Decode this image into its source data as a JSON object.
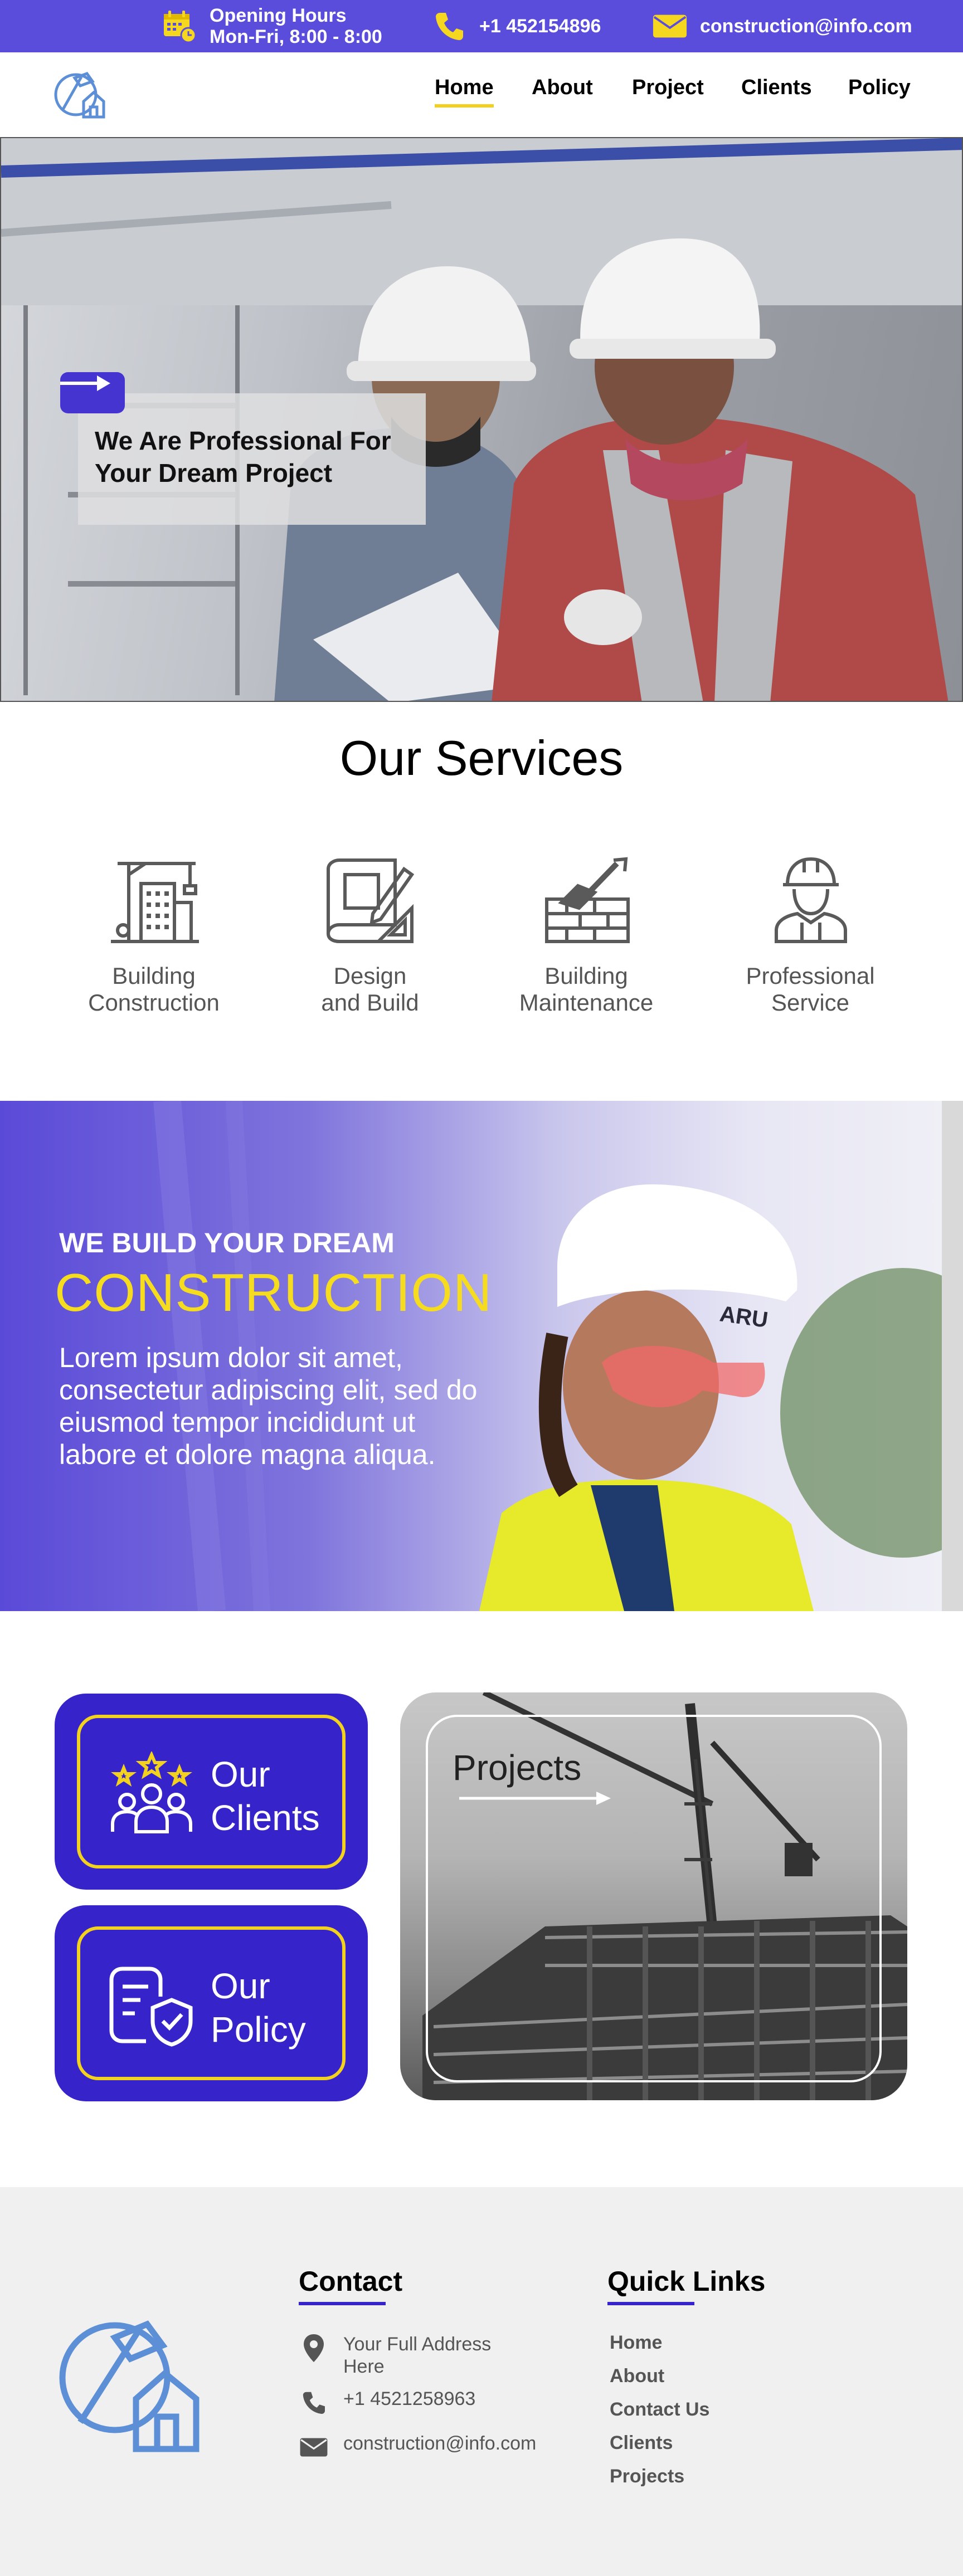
{
  "topbar": {
    "hours_title": "Opening Hours",
    "hours_value": "Mon-Fri, 8:00 - 8:00",
    "phone": "+1 452154896",
    "email": "construction@info.com",
    "icons": {
      "hours": "calendar-clock-icon",
      "phone": "phone-icon",
      "email": "envelope-icon"
    },
    "accent": "#f6d71f"
  },
  "nav": {
    "items": [
      {
        "label": "Home",
        "active": true
      },
      {
        "label": "About"
      },
      {
        "label": "Project"
      },
      {
        "label": "Clients"
      },
      {
        "label": "Policy"
      }
    ]
  },
  "hero": {
    "title": "We Are Professional For Your Dream Project",
    "button_icon": "arrow-right-icon"
  },
  "services": {
    "title": "Our Services",
    "items": [
      {
        "label": "Building\nConstruction",
        "icon": "crane-building-icon"
      },
      {
        "label": "Design\nand Build",
        "icon": "blueprint-pencil-icon"
      },
      {
        "label": "Building\nMaintenance",
        "icon": "brick-trowel-icon"
      },
      {
        "label": "Professional\nService",
        "icon": "worker-icon"
      }
    ]
  },
  "banner": {
    "kicker": "WE BUILD YOUR DREAM",
    "headline": "CONSTRUCTION",
    "body": "Lorem ipsum dolor sit amet, consectetur adipiscing elit, sed do eiusmod tempor incididunt ut labore et dolore magna aliqua."
  },
  "cards": {
    "clients": {
      "label": "Our\nClients",
      "icon": "team-stars-icon"
    },
    "policy": {
      "label": "Our\nPolicy",
      "icon": "document-shield-icon"
    },
    "projects": {
      "label": "Projects",
      "icon": "arrow-right-icon"
    }
  },
  "footer": {
    "contact_heading": "Contact",
    "quick_links_heading": "Quick Links",
    "address": "Your Full Address\nHere",
    "phone": "+1 4521258963",
    "email": "construction@info.com",
    "quick_links": [
      "Home",
      "About",
      "Contact Us",
      "Clients",
      "Projects"
    ]
  },
  "colors": {
    "brand_purple": "#5b4ddb",
    "card_blue": "#3623c9",
    "yellow": "#f3d11f",
    "footer_bg": "#f0f0f0"
  }
}
